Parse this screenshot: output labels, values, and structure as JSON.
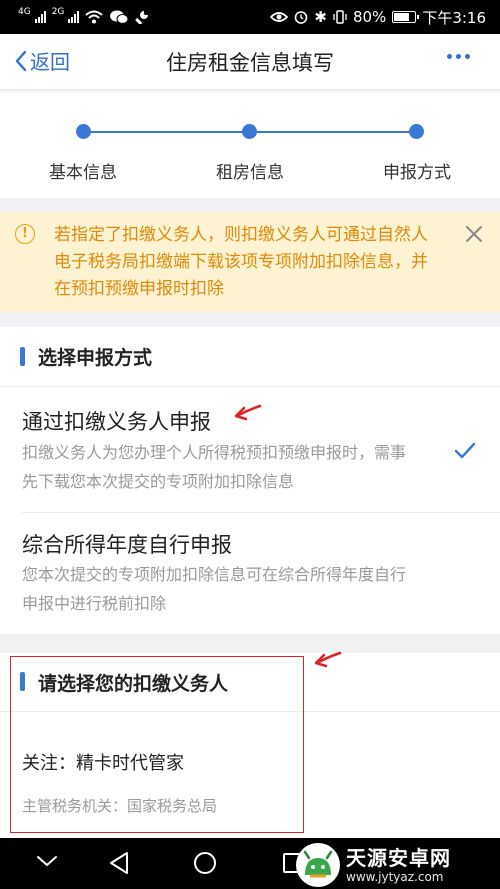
{
  "status_bar": {
    "signal_1": "4G",
    "signal_2": "2G",
    "battery": "80%",
    "time": "下午3:16",
    "battery_level": 0.8
  },
  "nav": {
    "back_label": "返回",
    "title": "住房租金信息填写"
  },
  "steps": [
    {
      "label": "基本信息"
    },
    {
      "label": "租房信息"
    },
    {
      "label": "申报方式"
    }
  ],
  "notice": {
    "icon_glyph": "!",
    "text": "若指定了扣缴义务人，则扣缴义务人可通过自然人电子税务局扣缴端下载该项专项附加扣除信息，并在预扣预缴申报时扣除"
  },
  "report_section": {
    "title": "选择申报方式",
    "options": [
      {
        "title": "通过扣缴义务人申报",
        "description": "扣缴义务人为您办理个人所得税预扣预缴申报时，需事先下载您本次提交的专项附加扣除信息",
        "selected": true
      },
      {
        "title": "综合所得年度自行申报",
        "description": "您本次提交的专项附加扣除信息可在综合所得年度自行申报中进行税前扣除",
        "selected": false
      }
    ]
  },
  "payer_section": {
    "title": "请选择您的扣缴义务人",
    "payer_label": "关注：精卡时代管家",
    "tax_authority": "主管税务机关：国家税务总局"
  },
  "watermark": {
    "name": "天源安卓网",
    "url": "www.jytyaz.com"
  },
  "colors": {
    "accent": "#3a78d8",
    "notice_bg": "#fdf2d2",
    "notice_text": "#e08a0c",
    "annotation_red": "#d9252a"
  }
}
